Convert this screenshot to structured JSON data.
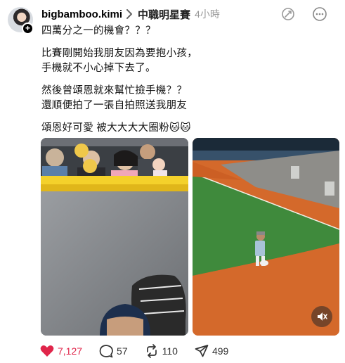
{
  "post": {
    "username": "bigbamboo.kimi",
    "topic": "中職明星賽",
    "time": "4小時",
    "paragraphs": [
      [
        "四萬分之一的機會？？？"
      ],
      [
        "比賽剛開始我朋友因為要抱小孩，",
        "手機就不小心掉下去了。"
      ],
      [
        "然後曾頌恩就來幫忙撿手機？？",
        "還順便拍了一張自拍照送我朋友"
      ],
      [
        "頌恩好可愛 被大大大大圈粉🐱🐱"
      ]
    ],
    "media": [
      {
        "kind": "photo",
        "icon": "selfie-photo"
      },
      {
        "kind": "video",
        "icon": "outfield-video",
        "muted": true
      }
    ],
    "actions": {
      "likes": "7,127",
      "comments": "57",
      "reposts": "110",
      "shares": "499"
    }
  },
  "colors": {
    "like": "#e0254a",
    "field_green": "#3f8a3c",
    "warning_track": "#d4692b"
  }
}
